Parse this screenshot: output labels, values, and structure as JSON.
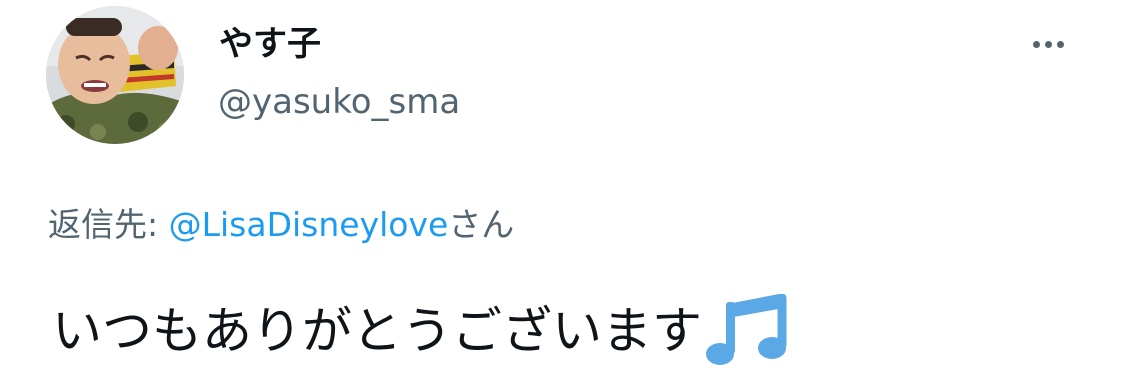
{
  "tweet": {
    "author": {
      "display_name": "やす子",
      "username": "@yasuko_sma",
      "avatar_icon": "user-avatar-photo"
    },
    "more_icon": "more-horizontal-icon",
    "reply_to": {
      "prefix": "返信先: ",
      "mention": "@LisaDisneylove",
      "suffix": "さん"
    },
    "text": "いつもありがとうございます",
    "emoji": "music-notes-emoji"
  },
  "colors": {
    "text_primary": "#0f1419",
    "text_secondary": "#536471",
    "link": "#1d9bf0",
    "emoji_blue": "#5aa9e6"
  }
}
